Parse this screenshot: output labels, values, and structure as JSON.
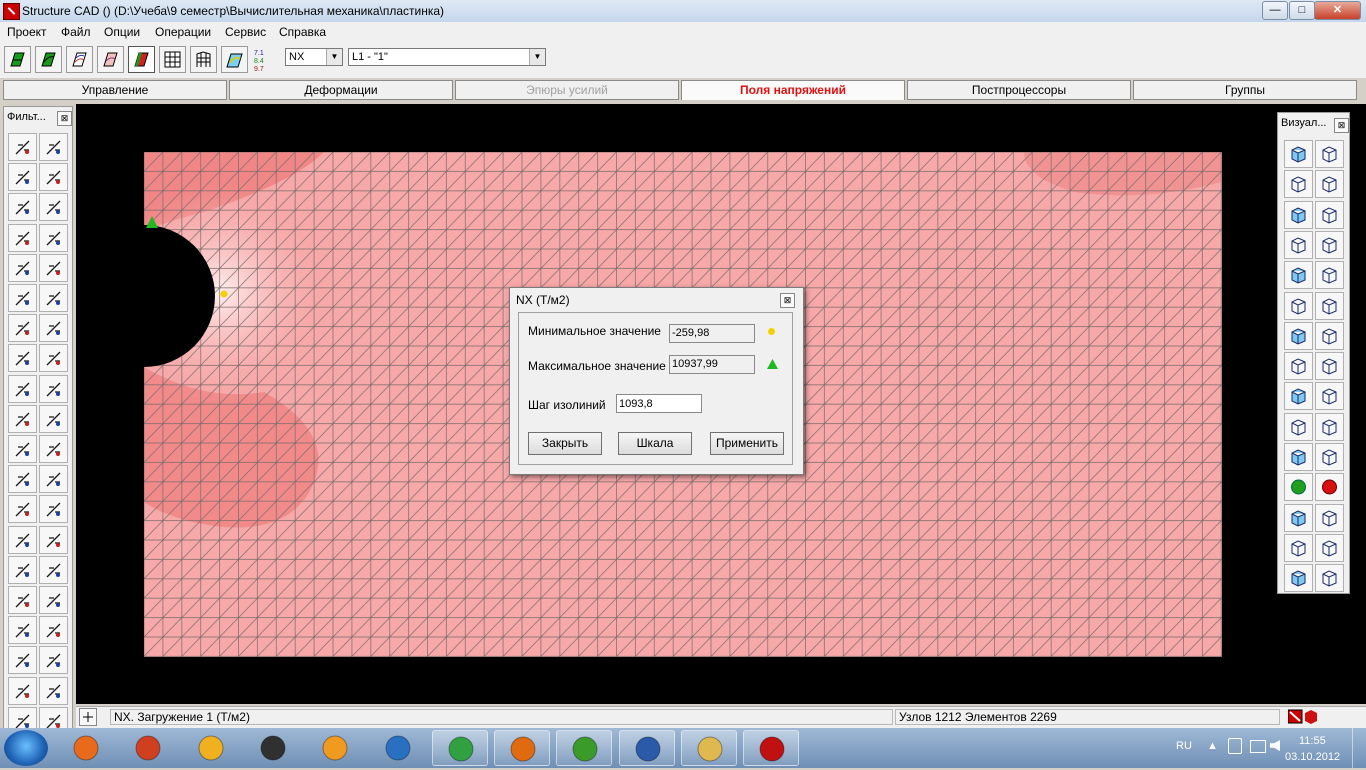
{
  "window": {
    "title": "Structure CAD () (D:\\Учеба\\9 семестр\\Вычислительная механика\\пластинка)",
    "minimize": "—",
    "maximize": "□",
    "close": "✕"
  },
  "menu": [
    "Проект",
    "Файл",
    "Опции",
    "Операции",
    "Сервис",
    "Справка"
  ],
  "toolbar": {
    "buttons": [
      "model-icon",
      "deformed-icon",
      "isolines-icon",
      "isofields-icon",
      "stress-field-icon",
      "grid-icon",
      "frame-icon",
      "contour-icon",
      "values-icon"
    ],
    "values_badge": [
      "7.1",
      "8.4",
      "9.7"
    ],
    "component_combo": "NX",
    "load_combo": "L1 - \"1\""
  },
  "tabs": [
    {
      "label": "Управление",
      "state": "normal"
    },
    {
      "label": "Деформации",
      "state": "normal"
    },
    {
      "label": "Эпюры усилий",
      "state": "disabled"
    },
    {
      "label": "Поля напряжений",
      "state": "active"
    },
    {
      "label": "Постпроцессоры",
      "state": "normal"
    },
    {
      "label": "Группы",
      "state": "normal"
    }
  ],
  "left_panel": {
    "title": "Фильт...",
    "close": "⊠"
  },
  "right_panel": {
    "title": "Визуал...",
    "close": "⊠"
  },
  "dialog": {
    "title": "NX (Т/м2)",
    "close": "⊠",
    "min_label": "Минимальное значение",
    "min_value": "-259,98",
    "max_label": "Максимальное значение",
    "max_value": "10937,99",
    "step_label": "Шаг изолиний",
    "step_value": "1093,8",
    "btn_close": "Закрыть",
    "btn_scale": "Шкала",
    "btn_apply": "Применить"
  },
  "status": {
    "load_text": "NX. Загружение 1 (Т/м2)",
    "counts_text": "Узлов 1212 Элементов 2269"
  },
  "taskbar": {
    "lang": "RU",
    "time": "11:55",
    "date": "03.10.2012"
  },
  "colors": {
    "field_base": "#f7a8a8",
    "field_high": "#f07878",
    "field_low": "#fde4e4",
    "active_tab": "#e01010",
    "min_marker": "#f5d000",
    "max_marker": "#22b822"
  }
}
